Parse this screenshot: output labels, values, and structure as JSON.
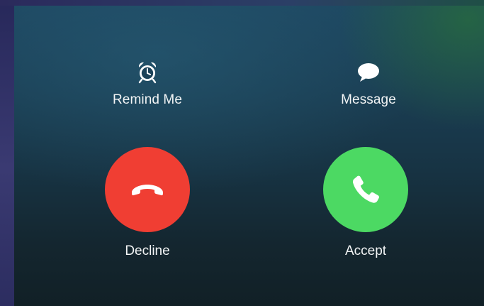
{
  "actions": {
    "remind": {
      "label": "Remind Me",
      "icon": "alarm-clock-icon"
    },
    "message": {
      "label": "Message",
      "icon": "speech-bubble-icon"
    }
  },
  "call": {
    "decline": {
      "label": "Decline",
      "icon": "phone-hangup-icon",
      "color": "#f03e33"
    },
    "accept": {
      "label": "Accept",
      "icon": "phone-icon",
      "color": "#4cd963"
    }
  }
}
